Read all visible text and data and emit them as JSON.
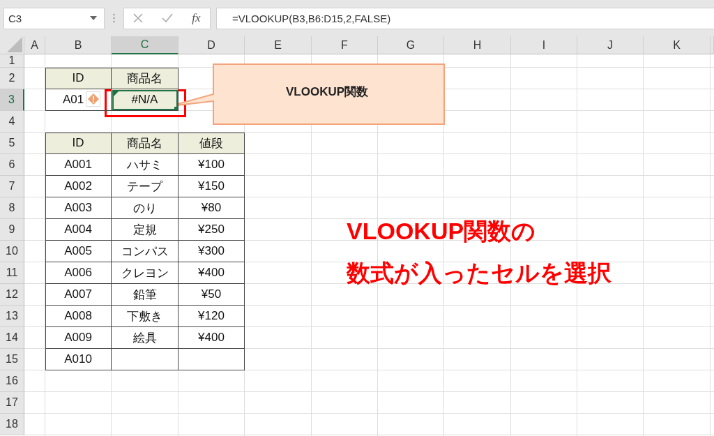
{
  "name_box": {
    "value": "C3"
  },
  "formula_bar": {
    "fx_label": "fx",
    "formula": "=VLOOKUP(B3,B6:D15,2,FALSE)"
  },
  "columns": [
    {
      "label": "A",
      "selected": false
    },
    {
      "label": "B",
      "selected": false
    },
    {
      "label": "C",
      "selected": true
    },
    {
      "label": "D",
      "selected": false
    },
    {
      "label": "E",
      "selected": false
    },
    {
      "label": "F",
      "selected": false
    },
    {
      "label": "G",
      "selected": false
    },
    {
      "label": "H",
      "selected": false
    },
    {
      "label": "I",
      "selected": false
    },
    {
      "label": "J",
      "selected": false
    },
    {
      "label": "K",
      "selected": false
    }
  ],
  "rows": [
    {
      "label": "1",
      "selected": false
    },
    {
      "label": "2",
      "selected": false
    },
    {
      "label": "3",
      "selected": true
    },
    {
      "label": "4",
      "selected": false
    },
    {
      "label": "5",
      "selected": false
    },
    {
      "label": "6",
      "selected": false
    },
    {
      "label": "7",
      "selected": false
    },
    {
      "label": "8",
      "selected": false
    },
    {
      "label": "9",
      "selected": false
    },
    {
      "label": "10",
      "selected": false
    },
    {
      "label": "11",
      "selected": false
    },
    {
      "label": "12",
      "selected": false
    },
    {
      "label": "13",
      "selected": false
    },
    {
      "label": "14",
      "selected": false
    },
    {
      "label": "15",
      "selected": false
    },
    {
      "label": "16",
      "selected": false
    },
    {
      "label": "17",
      "selected": false
    },
    {
      "label": "18",
      "selected": false
    }
  ],
  "input_table": {
    "header": [
      "ID",
      "商品名"
    ],
    "row": [
      "A01",
      "#N/A"
    ]
  },
  "lookup_table": {
    "header": [
      "ID",
      "商品名",
      "値段"
    ],
    "rows": [
      [
        "A001",
        "ハサミ",
        "¥100"
      ],
      [
        "A002",
        "テープ",
        "¥150"
      ],
      [
        "A003",
        "のり",
        "¥80"
      ],
      [
        "A004",
        "定規",
        "¥250"
      ],
      [
        "A005",
        "コンパス",
        "¥300"
      ],
      [
        "A006",
        "クレヨン",
        "¥400"
      ],
      [
        "A007",
        "鉛筆",
        "¥50"
      ],
      [
        "A008",
        "下敷き",
        "¥120"
      ],
      [
        "A009",
        "絵具",
        "¥400"
      ],
      [
        "A010"
      ]
    ]
  },
  "callout": {
    "text": "VLOOKUP関数"
  },
  "annotation": {
    "lines": [
      "VLOOKUP関数の",
      "数式が入ったセルを選択"
    ]
  }
}
